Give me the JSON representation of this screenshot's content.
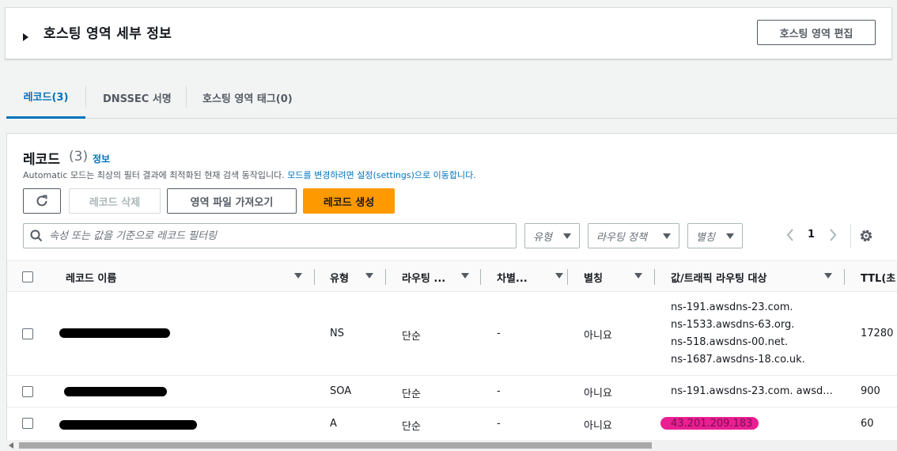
{
  "zone_details": {
    "title": "호스팅 영역 세부 정보",
    "edit_label": "호스팅 영역 편집"
  },
  "tabs": [
    {
      "label": "레코드(3)",
      "active": true
    },
    {
      "label": "DNSSEC 서명",
      "active": false
    },
    {
      "label": "호스팅 영역 태그(0)",
      "active": false
    }
  ],
  "records": {
    "title": "레코드",
    "count": "(3)",
    "info": "정보",
    "desc_prefix": "Automatic 모드는 최상의 필터 결과에 최적화된 현재 검색 동작입니다. ",
    "desc_link": "모드를 변경하려면 설정(settings)으로 이동합니다.",
    "delete_label": "레코드 삭제",
    "import_label": "영역 파일 가져오기",
    "create_label": "레코드 생성",
    "filter_placeholder": "속성 또는 값을 기준으로 레코드 필터링",
    "type_dd": "유형",
    "routing_dd": "라우팅 정책",
    "alias_dd": "별칭",
    "page": "1"
  },
  "columns": {
    "name": "레코드 이름",
    "type": "유형",
    "routing": "라우팅 ...",
    "diff": "차별...",
    "alias": "별칭",
    "value": "값/트래픽 라우팅 대상",
    "ttl": "TTL(초"
  },
  "rows": [
    {
      "type": "NS",
      "routing": "단순",
      "diff": "-",
      "alias": "아니요",
      "values": [
        "ns-191.awsdns-23.com.",
        "ns-1533.awsdns-63.org.",
        "ns-518.awsdns-00.net.",
        "ns-1687.awsdns-18.co.uk."
      ],
      "ttl": "17280"
    },
    {
      "type": "SOA",
      "routing": "단순",
      "diff": "-",
      "alias": "아니요",
      "values": [
        "ns-191.awsdns-23.com. awsd..."
      ],
      "ttl": "900"
    },
    {
      "type": "A",
      "routing": "단순",
      "diff": "-",
      "alias": "아니요",
      "values": [
        "43.201.209.183"
      ],
      "ttl": "60"
    }
  ],
  "colors": {
    "accent": "#0073bb",
    "primary": "#ff9900",
    "redact_pink": "#e8138c"
  }
}
